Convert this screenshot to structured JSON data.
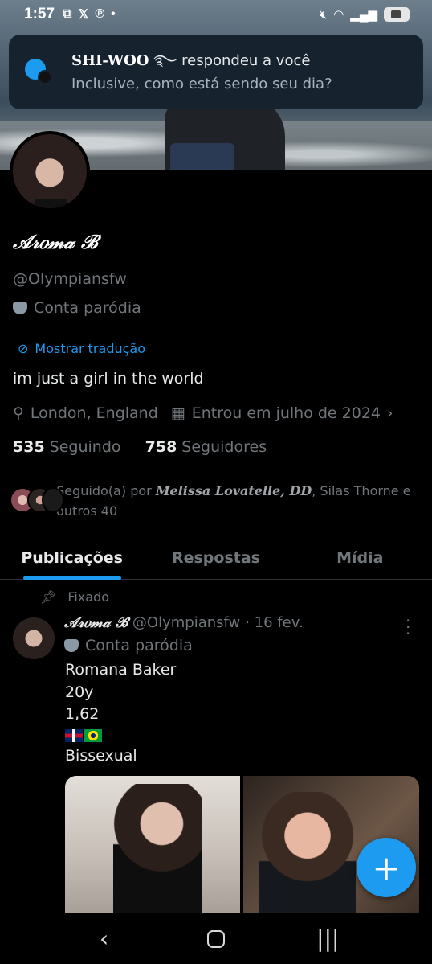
{
  "status_bar": {
    "time": "1:57",
    "icons": [
      "screenshot-icon",
      "x-logo-icon",
      "pinterest-icon",
      "dot"
    ],
    "right_icons": [
      "mute-icon",
      "wifi-icon",
      "signal-icon",
      "battery-icon"
    ]
  },
  "notification": {
    "name": "SHI-WOO",
    "name_symbol": "࿐",
    "action": "respondeu a você",
    "message": "Inclusive, como está sendo seu dia?"
  },
  "profile": {
    "display_name": "𝒜𝓇𝑜𝓂𝒶 ℬ",
    "handle": "@Olympiansfw",
    "label": "Conta paródia",
    "translate_link": "Mostrar tradução",
    "bio": "im just a girl in the world",
    "location": "London, England",
    "joined": "Entrou em julho de 2024",
    "following_count": "535",
    "following_label": "Seguindo",
    "followers_count": "758",
    "followers_label": "Seguidores",
    "followed_by_prefix": "Seguido(a) por",
    "followed_by_names": "Melissa Lovatelle, DD",
    "followed_by_rest": ", Silas Thorne e outros 40"
  },
  "tabs": [
    {
      "label": "Publicações",
      "active": true
    },
    {
      "label": "Respostas",
      "active": false
    },
    {
      "label": "Mídia",
      "active": false
    }
  ],
  "pinned_post": {
    "pinned_label": "Fixado",
    "author_name": "𝒜𝓇𝑜𝓂𝒶 ℬ",
    "author_handle": "@Olympiansfw",
    "date": "· 16 fev.",
    "author_label": "Conta paródia",
    "lines": [
      "Romana Baker",
      "20y",
      "1,62"
    ],
    "last_line": "Bissexual"
  },
  "fab": {
    "label": "+"
  },
  "colors": {
    "accent": "#1d9bf0",
    "background": "#000000",
    "secondary_text": "#71767b",
    "primary_text": "#e7e9ea"
  }
}
